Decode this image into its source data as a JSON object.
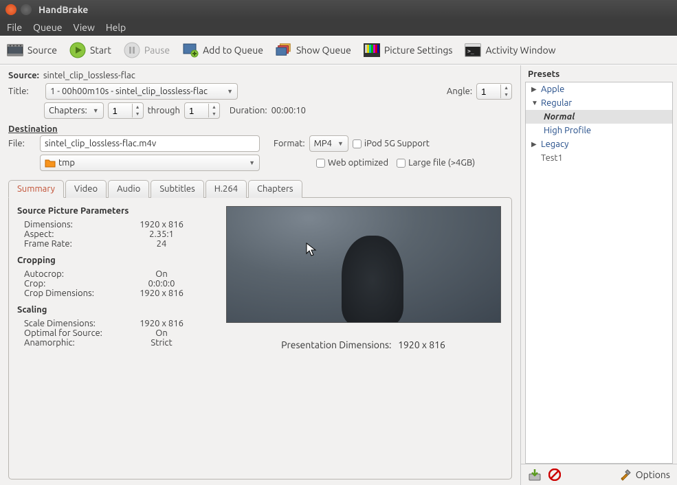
{
  "window": {
    "title": "HandBrake"
  },
  "menubar": {
    "file": "File",
    "queue": "Queue",
    "view": "View",
    "help": "Help"
  },
  "toolbar": {
    "source": "Source",
    "start": "Start",
    "pause": "Pause",
    "add_queue": "Add to Queue",
    "show_queue": "Show Queue",
    "picture_settings": "Picture Settings",
    "activity_window": "Activity Window"
  },
  "source": {
    "label": "Source:",
    "name": "sintel_clip_lossless-flac"
  },
  "title": {
    "label": "Title:",
    "selected": "1 - 00h00m10s - sintel_clip_lossless-flac",
    "angle_label": "Angle:",
    "angle": "1",
    "chapters_label": "Chapters:",
    "chapter_from": "1",
    "through": "through",
    "chapter_to": "1",
    "duration_label": "Duration:",
    "duration": "00:00:10"
  },
  "destination": {
    "heading": "Destination",
    "file_label": "File:",
    "file": "sintel_clip_lossless-flac.m4v",
    "folder": "tmp",
    "format_label": "Format:",
    "format": "MP4",
    "ipod": "iPod 5G Support",
    "web_opt": "Web optimized",
    "large_file": "Large file (>4GB)"
  },
  "tabs": {
    "summary": "Summary",
    "video": "Video",
    "audio": "Audio",
    "subtitles": "Subtitles",
    "h264": "H.264",
    "chapters": "Chapters"
  },
  "summary": {
    "spp_head": "Source Picture Parameters",
    "dimensions_k": "Dimensions:",
    "dimensions_v": "1920 x 816",
    "aspect_k": "Aspect:",
    "aspect_v": "2.35:1",
    "framerate_k": "Frame Rate:",
    "framerate_v": "24",
    "cropping_head": "Cropping",
    "autocrop_k": "Autocrop:",
    "autocrop_v": "On",
    "crop_k": "Crop:",
    "crop_v": "0:0:0:0",
    "cropdim_k": "Crop Dimensions:",
    "cropdim_v": "1920 x 816",
    "scaling_head": "Scaling",
    "scaledim_k": "Scale Dimensions:",
    "scaledim_v": "1920 x 816",
    "optimal_k": "Optimal for Source:",
    "optimal_v": "On",
    "anamorphic_k": "Anamorphic:",
    "anamorphic_v": "Strict",
    "pres_dim_k": "Presentation Dimensions:",
    "pres_dim_v": "1920 x 816"
  },
  "presets": {
    "heading": "Presets",
    "apple": "Apple",
    "regular": "Regular",
    "normal": "Normal",
    "high_profile": "High Profile",
    "legacy": "Legacy",
    "test1": "Test1",
    "options": "Options"
  }
}
